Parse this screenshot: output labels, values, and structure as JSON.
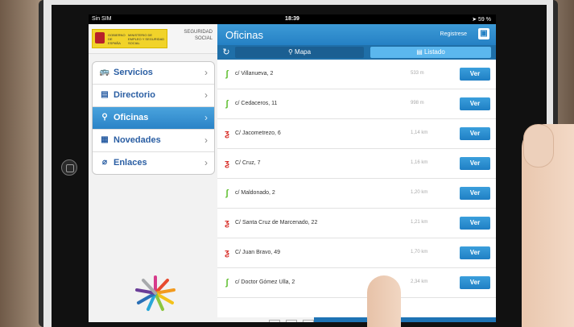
{
  "status": {
    "carrier": "Sin SIM",
    "time": "18:39",
    "battery": "59 %"
  },
  "logo": {
    "gob_left": "GOBIERNO DE ESPAÑA",
    "gob_right": "MINISTERIO DE EMPLEO Y SEGURIDAD SOCIAL",
    "ss_line1": "SEGURIDAD",
    "ss_line2": "SOCIAL"
  },
  "menu": {
    "items": [
      {
        "label": "Servicios",
        "icon": "bus-icon",
        "glyph": "🚌"
      },
      {
        "label": "Directorio",
        "icon": "book-icon",
        "glyph": "▤"
      },
      {
        "label": "Oficinas",
        "icon": "location-pin-icon",
        "glyph": "⚲"
      },
      {
        "label": "Novedades",
        "icon": "news-icon",
        "glyph": "▦"
      },
      {
        "label": "Enlaces",
        "icon": "paperclip-icon",
        "glyph": "⌀"
      }
    ],
    "active_index": 2
  },
  "navbar": {
    "title": "Oficinas",
    "register": "Registrese"
  },
  "segments": {
    "map": "⚲ Mapa",
    "list": "▤ Listado"
  },
  "offices": [
    {
      "address": "c/ Villanueva, 2",
      "distance": "533 m",
      "type": "green",
      "action": "Ver"
    },
    {
      "address": "c/ Cedaceros, 11",
      "distance": "998 m",
      "type": "green",
      "action": "Ver"
    },
    {
      "address": "C/ Jacometrezo, 6",
      "distance": "1,14 km",
      "type": "red",
      "action": "Ver"
    },
    {
      "address": "C/ Cruz, 7",
      "distance": "1,16 km",
      "type": "red",
      "action": "Ver"
    },
    {
      "address": "c/ Maldonado, 2",
      "distance": "1,20 km",
      "type": "green",
      "action": "Ver"
    },
    {
      "address": "C/ Santa Cruz de Marcenado, 22",
      "distance": "1,21 km",
      "type": "red",
      "action": "Ver"
    },
    {
      "address": "C/ Juan Bravo, 49",
      "distance": "1,70 km",
      "type": "red",
      "action": "Ver"
    },
    {
      "address": "c/ Doctor Gómez Ulla, 2",
      "distance": "2,34 km",
      "type": "green",
      "action": "Ver"
    }
  ],
  "colors": {
    "accent": "#2581c4",
    "green": "#5fbf2f",
    "red": "#d8302a"
  }
}
